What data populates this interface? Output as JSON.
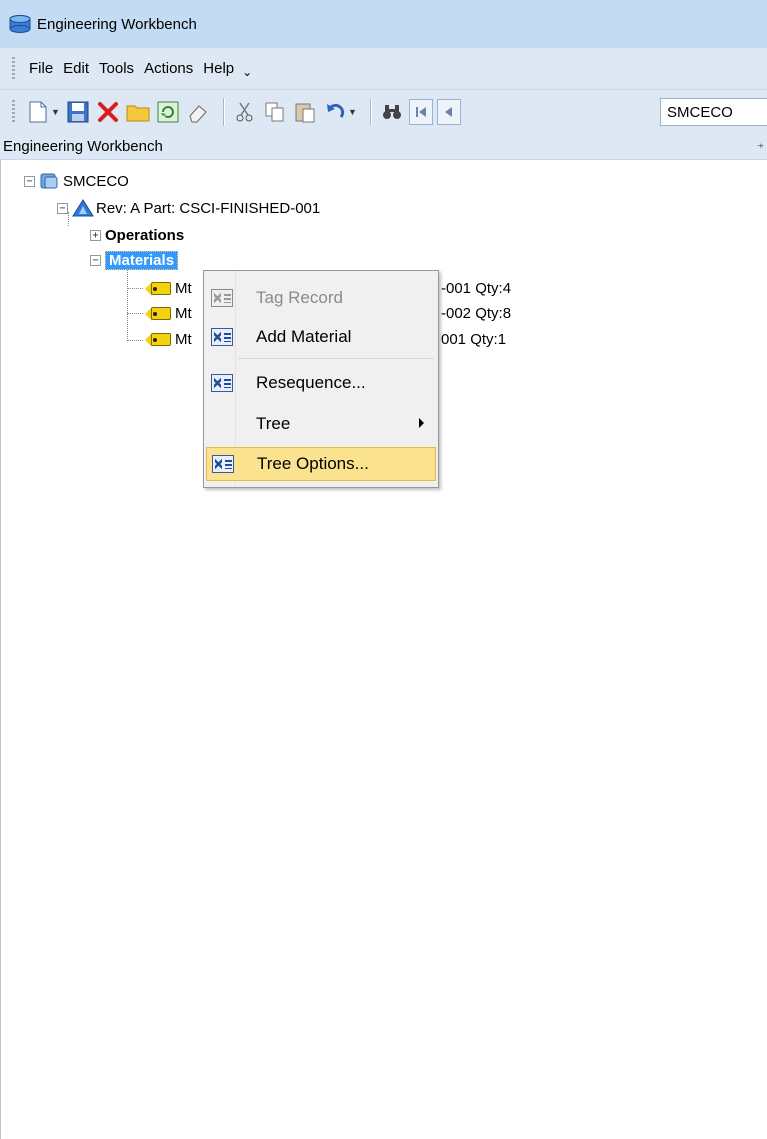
{
  "window": {
    "title": "Engineering Workbench",
    "icon": "database-icon"
  },
  "menubar": {
    "items": [
      "File",
      "Edit",
      "Tools",
      "Actions",
      "Help"
    ],
    "overflow": "⌄"
  },
  "toolbar": {
    "buttons": [
      "new-icon",
      "save-icon",
      "delete-icon",
      "folder-icon",
      "refresh-icon",
      "eraser-icon",
      "cut-icon",
      "copy-icon",
      "paste-icon",
      "undo-icon",
      "find-icon",
      "first-record-icon",
      "previous-record-icon"
    ],
    "search_value": "SMCECO"
  },
  "panel": {
    "title": "Engineering Workbench",
    "pin": "⍆"
  },
  "tree": {
    "root": {
      "label": "SMCECO",
      "expander": "−"
    },
    "revision": {
      "label": "Rev: A Part: CSCI-FINISHED-001",
      "expander": "−"
    },
    "operations": {
      "label": "Operations",
      "expander": "+"
    },
    "materials": {
      "label": "Materials",
      "expander": "−"
    },
    "material_rows": [
      {
        "prefix": "Mt",
        "suffix": "-001  Qty:4"
      },
      {
        "prefix": "Mt",
        "suffix": "-002  Qty:8"
      },
      {
        "prefix": "Mt",
        "suffix": "001  Qty:1"
      }
    ]
  },
  "context_menu": {
    "items": [
      {
        "label": "Tag Record",
        "disabled": true
      },
      {
        "label": "Add Material"
      },
      {
        "label": "Resequence..."
      },
      {
        "label": "Tree",
        "has_submenu": true
      },
      {
        "label": "Tree Options...",
        "highlighted": true
      }
    ]
  }
}
